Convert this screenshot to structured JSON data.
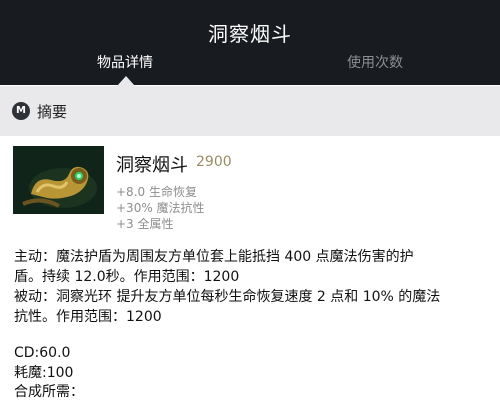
{
  "header": {
    "title": "洞察烟斗",
    "tabs": [
      {
        "label": "物品详情",
        "active": true
      },
      {
        "label": "使用次数",
        "active": false
      }
    ]
  },
  "section": {
    "icon": "m-badge-icon",
    "label": "摘要"
  },
  "item": {
    "name": "洞察烟斗",
    "cost": "2900",
    "image": "insight-pipe-item-image",
    "stats": [
      "+8.0 生命恢复",
      "+30% 魔法抗性",
      "+3 全属性"
    ]
  },
  "description": {
    "lines": [
      "主动：魔法护盾为周围友方单位套上能抵挡 400 点魔法伤害的护",
      "盾。持续 12.0秒。作用范围：1200",
      "被动：洞察光环 提升友方单位每秒生命恢复速度 2 点和 10% 的魔法",
      "抗性。作用范围：1200",
      "",
      "CD:60.0",
      "耗魔:100",
      "合成所需："
    ]
  },
  "colors": {
    "header_bg": "#181b20",
    "section_bg": "#e9e9ec",
    "cost_gold": "#9a8b63",
    "stat_gray": "#8d8d8d"
  }
}
